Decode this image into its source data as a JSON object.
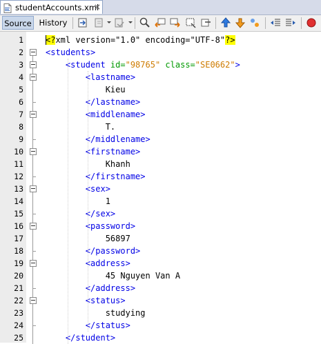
{
  "tab": {
    "title": "studentAccounts.xml",
    "close": "×"
  },
  "toolbar": {
    "source_label": "Source",
    "history_label": "History"
  },
  "editor": {
    "line_numbers": [
      "1",
      "2",
      "3",
      "4",
      "5",
      "6",
      "7",
      "8",
      "9",
      "10",
      "11",
      "12",
      "13",
      "14",
      "15",
      "16",
      "17",
      "18",
      "19",
      "20",
      "21",
      "22",
      "23",
      "24",
      "25"
    ],
    "lines": [
      {
        "tokens": [
          {
            "t": "<?",
            "c": "hl pi"
          },
          {
            "t": "xml version=\"1.0\" encoding=\"UTF-8\"",
            "c": "pi"
          },
          {
            "t": "?>",
            "c": "hl pi"
          }
        ]
      },
      {
        "tokens": [
          {
            "t": "<students>",
            "c": "tag"
          }
        ]
      },
      {
        "tokens": [
          {
            "t": "    <student ",
            "c": "tag"
          },
          {
            "t": "id=",
            "c": "attrn"
          },
          {
            "t": "\"98765\"",
            "c": "attrv"
          },
          {
            "t": " ",
            "c": ""
          },
          {
            "t": "class=",
            "c": "attrn"
          },
          {
            "t": "\"SE0662\"",
            "c": "attrv"
          },
          {
            "t": ">",
            "c": "tag"
          }
        ]
      },
      {
        "tokens": [
          {
            "t": "        <lastname>",
            "c": "tag"
          }
        ]
      },
      {
        "tokens": [
          {
            "t": "            Kieu",
            "c": ""
          }
        ]
      },
      {
        "tokens": [
          {
            "t": "        </lastname>",
            "c": "tag"
          }
        ]
      },
      {
        "tokens": [
          {
            "t": "        <middlename>",
            "c": "tag"
          }
        ]
      },
      {
        "tokens": [
          {
            "t": "            T.",
            "c": ""
          }
        ]
      },
      {
        "tokens": [
          {
            "t": "        </middlename>",
            "c": "tag"
          }
        ]
      },
      {
        "tokens": [
          {
            "t": "        <firstname>",
            "c": "tag"
          }
        ]
      },
      {
        "tokens": [
          {
            "t": "            Khanh",
            "c": ""
          }
        ]
      },
      {
        "tokens": [
          {
            "t": "        </firstname>",
            "c": "tag"
          }
        ]
      },
      {
        "tokens": [
          {
            "t": "        <sex>",
            "c": "tag"
          }
        ]
      },
      {
        "tokens": [
          {
            "t": "            1",
            "c": ""
          }
        ]
      },
      {
        "tokens": [
          {
            "t": "        </sex>",
            "c": "tag"
          }
        ]
      },
      {
        "tokens": [
          {
            "t": "        <password>",
            "c": "tag"
          }
        ]
      },
      {
        "tokens": [
          {
            "t": "            56897",
            "c": ""
          }
        ]
      },
      {
        "tokens": [
          {
            "t": "        </password>",
            "c": "tag"
          }
        ]
      },
      {
        "tokens": [
          {
            "t": "        <address>",
            "c": "tag"
          }
        ]
      },
      {
        "tokens": [
          {
            "t": "            45 Nguyen Van A",
            "c": ""
          }
        ]
      },
      {
        "tokens": [
          {
            "t": "        </address>",
            "c": "tag"
          }
        ]
      },
      {
        "tokens": [
          {
            "t": "        <status>",
            "c": "tag"
          }
        ]
      },
      {
        "tokens": [
          {
            "t": "            studying",
            "c": ""
          }
        ]
      },
      {
        "tokens": [
          {
            "t": "        </status>",
            "c": "tag"
          }
        ]
      },
      {
        "tokens": [
          {
            "t": "    </student>",
            "c": "tag"
          }
        ]
      }
    ],
    "fold_open_lines": [
      2,
      3,
      4,
      7,
      10,
      13,
      16,
      19,
      22
    ],
    "fold_close_lines": [
      6,
      9,
      12,
      15,
      18,
      21,
      24
    ]
  },
  "icons": [
    "xml-file-icon",
    "last-edit-icon",
    "back-icon",
    "forward-icon",
    "find-icon",
    "find-previous-icon",
    "find-next-icon",
    "find-selection-icon",
    "toggle-bookmark-icon",
    "previous-bookmark-icon",
    "next-bookmark-icon",
    "shift-left-icon",
    "shift-right-icon",
    "record-macro-icon"
  ],
  "colors": {
    "tag": "#0000e6",
    "attribute_name": "#009900",
    "attribute_value": "#ce7b00",
    "highlight": "#ffff00",
    "source_active": "#c9d7ea"
  }
}
